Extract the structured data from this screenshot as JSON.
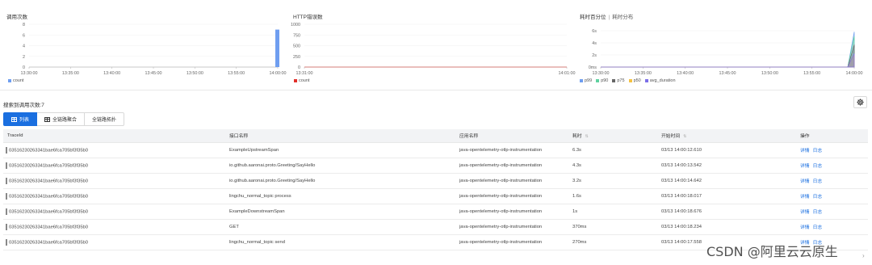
{
  "charts": {
    "calls": {
      "title": "调用次数",
      "yticks": [
        "8",
        "6",
        "4",
        "2",
        "0"
      ],
      "xticks": [
        "13:30:00",
        "13:35:00",
        "13:40:00",
        "13:45:00",
        "13:50:00",
        "13:55:00",
        "14:00:00"
      ],
      "legend": [
        {
          "label": "count",
          "color": "#6f9ef0"
        }
      ]
    },
    "errors": {
      "title": "HTTP错误数",
      "yticks": [
        "1000",
        "750",
        "500",
        "250",
        "0"
      ],
      "xticks": [
        "13:31:00",
        "14:01:00"
      ],
      "legend": [
        {
          "label": "count",
          "color": "#e2302b"
        }
      ]
    },
    "latency": {
      "title": "耗时百分位",
      "sep": "|",
      "subtitle": "耗时分布",
      "yticks": [
        "6s",
        "4s",
        "2s",
        "0ms"
      ],
      "xticks": [
        "13:30:00",
        "13:35:00",
        "13:40:00",
        "13:45:00",
        "13:50:00",
        "13:55:00",
        "14:00:00"
      ],
      "legend": [
        {
          "label": "p99",
          "color": "#6f9ef0"
        },
        {
          "label": "p90",
          "color": "#5fd2a0"
        },
        {
          "label": "p75",
          "color": "#666666"
        },
        {
          "label": "p50",
          "color": "#f5c242"
        },
        {
          "label": "avg_duration",
          "color": "#7c6fe8"
        }
      ]
    }
  },
  "chart_data": [
    {
      "type": "bar",
      "title": "调用次数",
      "categories": [
        "13:30:00",
        "13:35:00",
        "13:40:00",
        "13:45:00",
        "13:50:00",
        "13:55:00",
        "14:00:00"
      ],
      "series": [
        {
          "name": "count",
          "values": [
            0,
            0,
            0,
            0,
            0,
            0,
            7
          ]
        }
      ],
      "ylim": [
        0,
        8
      ]
    },
    {
      "type": "line",
      "title": "HTTP错误数",
      "x": [
        "13:31:00",
        "14:01:00"
      ],
      "series": [
        {
          "name": "count",
          "values": [
            0,
            0
          ]
        }
      ],
      "ylim": [
        0,
        1000
      ]
    },
    {
      "type": "area",
      "title": "耗时百分位",
      "x": [
        "13:30:00",
        "13:35:00",
        "13:40:00",
        "13:45:00",
        "13:50:00",
        "13:55:00",
        "14:00:00"
      ],
      "series": [
        {
          "name": "p99",
          "values": [
            0,
            0,
            0,
            0,
            0,
            0,
            6.3
          ]
        },
        {
          "name": "p90",
          "values": [
            0,
            0,
            0,
            0,
            0,
            0,
            5.5
          ]
        },
        {
          "name": "p75",
          "values": [
            0,
            0,
            0,
            0,
            0,
            0,
            4.0
          ]
        },
        {
          "name": "p50",
          "values": [
            0,
            0,
            0,
            0,
            0,
            0,
            2.3
          ]
        },
        {
          "name": "avg_duration",
          "values": [
            0,
            0,
            0,
            0,
            0,
            0,
            2.4
          ]
        }
      ],
      "ylim": [
        0,
        6.5
      ]
    }
  ],
  "summary": "搜索到调用次数:7",
  "tabs": [
    {
      "label": "列表",
      "active": true
    },
    {
      "label": "全链路聚合",
      "active": false
    },
    {
      "label": "全链路拓扑",
      "active": false
    }
  ],
  "table": {
    "headers": [
      "TraceId",
      "接口名称",
      "应用名称",
      "耗时",
      "开始时间",
      "操作"
    ],
    "sort_icon": "⇅",
    "rows": [
      {
        "trace": "03516230263341bae6fca705bf3f35b0",
        "api": "ExampleUpstreamSpan",
        "app": "java-opentelemetry-otlp-instrumentation",
        "dur": "6.3s",
        "start": "03/13 14:00:12.610",
        "detail": "详情",
        "log": "日志"
      },
      {
        "trace": "03516230263341bae6fca705bf3f35b0",
        "api": "io.github.aaronai.proto.Greeting/SayHello",
        "app": "java-opentelemetry-otlp-instrumentation",
        "dur": "4.3s",
        "start": "03/13 14:00:13.542",
        "detail": "详情",
        "log": "日志"
      },
      {
        "trace": "03516230263341bae6fca705bf3f35b0",
        "api": "io.github.aaronai.proto.Greeting/SayHello",
        "app": "java-opentelemetry-otlp-instrumentation",
        "dur": "3.2s",
        "start": "03/13 14:00:14.642",
        "detail": "详情",
        "log": "日志"
      },
      {
        "trace": "03516230263341bae6fca705bf3f35b0",
        "api": "lingchu_normal_topic process",
        "app": "java-opentelemetry-otlp-instrumentation",
        "dur": "1.6s",
        "start": "03/13 14:00:18.017",
        "detail": "详情",
        "log": "日志"
      },
      {
        "trace": "03516230263341bae6fca705bf3f35b0",
        "api": "ExampleDownstreamSpan",
        "app": "java-opentelemetry-otlp-instrumentation",
        "dur": "1s",
        "start": "03/13 14:00:18.676",
        "detail": "详情",
        "log": "日志"
      },
      {
        "trace": "03516230263341bae6fca705bf3f35b0",
        "api": "GET",
        "app": "java-opentelemetry-otlp-instrumentation",
        "dur": "370ms",
        "start": "03/13 14:00:18.234",
        "detail": "详情",
        "log": "日志"
      },
      {
        "trace": "03516230263341bae6fca705bf3f35b0",
        "api": "lingchu_normal_topic send",
        "app": "java-opentelemetry-otlp-instrumentation",
        "dur": "270ms",
        "start": "03/13 14:00:17.558",
        "detail": "详情",
        "log": "日志"
      }
    ]
  },
  "watermark": "CSDN @阿里云云原生",
  "icons": {
    "settings": "gear-icon",
    "tab": "table-icon",
    "scroll": "chevron-right-icon"
  }
}
